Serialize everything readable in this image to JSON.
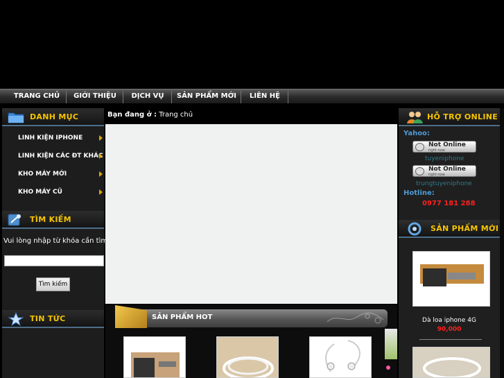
{
  "nav": {
    "items": [
      "TRANG CHỦ",
      "GIỚI THIỆU",
      "DỊCH VỤ",
      "SẢN PHẨM MỚI",
      "LIÊN HỆ"
    ]
  },
  "left": {
    "category_title": "DANH MỤC",
    "categories": [
      "LINH KIỆN IPHONE",
      "LINH KIỆN CÁC ĐT KHÁC",
      "KHO MÁY MỚI",
      "KHO MÁY CŨ"
    ],
    "search_title": "TÌM KIẾM",
    "search_label": "Vui lòng nhập từ khóa cần tìm:",
    "search_value": "",
    "search_button": "Tìm kiếm",
    "news_title": "TIN TỨC"
  },
  "center": {
    "breadcrumb_prefix": "Bạn đang ở :",
    "breadcrumb_current": "Trang chủ",
    "hot_title": "SẢN PHẨM HOT"
  },
  "right": {
    "support_title": "HỖ TRỢ ONLINE",
    "yahoo_label": "Yahoo:",
    "yahoo_status": "Not Online",
    "yahoo_status_sub": "right now",
    "yahoo_users": [
      "tuyeniphone",
      "trungtuyeniphone"
    ],
    "hotline_label": "Hotline:",
    "hotline_number": "0977 181 288",
    "new_title": "SẢN PHẨM MỚI",
    "new_products": [
      {
        "name": "Dà loa iphone 4G",
        "price": "90,000"
      }
    ]
  },
  "colors": {
    "accent_title": "#f5c400",
    "link_blue": "#4f9bd6",
    "price_red": "#ff2020"
  }
}
